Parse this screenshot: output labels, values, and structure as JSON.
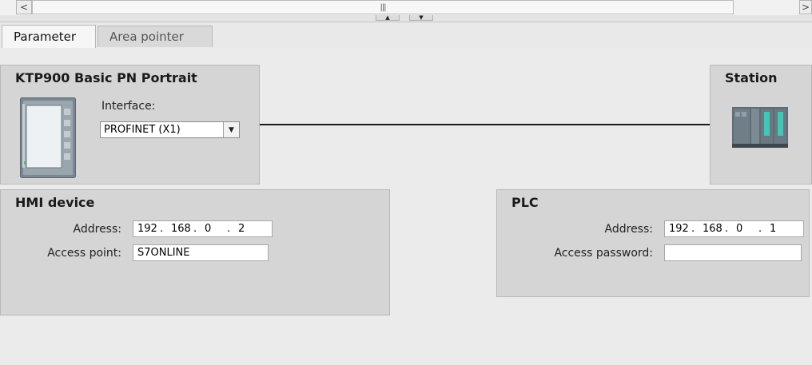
{
  "scrollbar": {
    "left_arrow": "<",
    "right_arrow": ">",
    "grip": "|||",
    "split_up": "▲",
    "split_down": "▼"
  },
  "tabs": [
    {
      "label": "Parameter",
      "active": true
    },
    {
      "label": "Area pointer",
      "active": false
    }
  ],
  "hmi_panel": {
    "title": "KTP900 Basic PN Portrait",
    "interface_label": "Interface:",
    "interface_value": "PROFINET (X1)",
    "dropdown_icon": "chevron-down-icon"
  },
  "station_panel": {
    "title": "Station"
  },
  "hmi_device": {
    "title": "HMI device",
    "address_label": "Address:",
    "address": [
      "192",
      "168",
      "0",
      "2"
    ],
    "access_point_label": "Access point:",
    "access_point_value": "S7ONLINE"
  },
  "plc": {
    "title": "PLC",
    "address_label": "Address:",
    "address": [
      "192",
      "168",
      "0",
      "1"
    ],
    "access_password_label": "Access password:",
    "access_password_value": ""
  },
  "colors": {
    "panel_bg": "#d5d5d5",
    "background": "#ebebeb",
    "connection_line": "#1a1a1a"
  }
}
